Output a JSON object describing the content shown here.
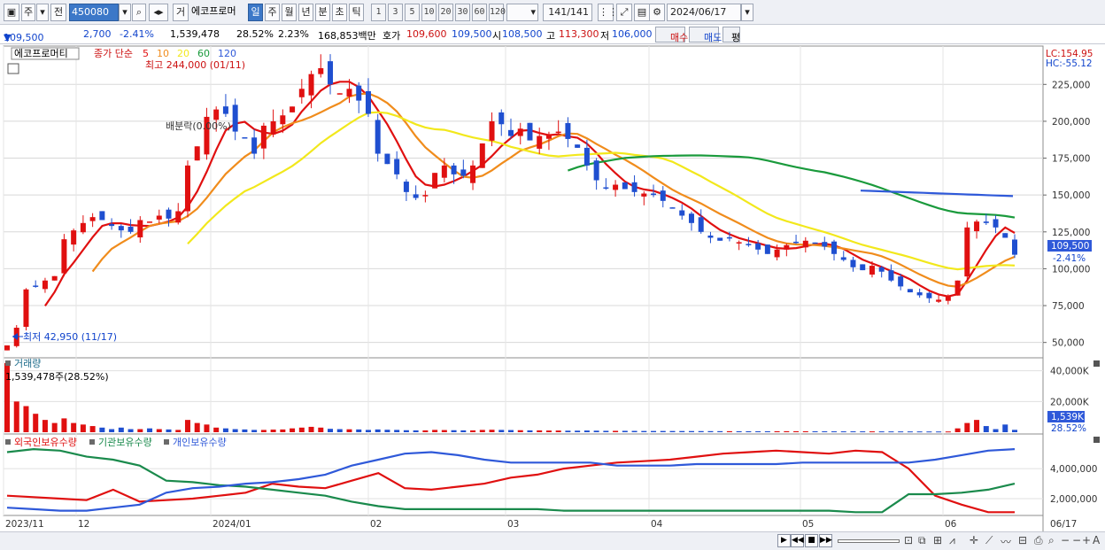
{
  "toolbar": {
    "market": "주",
    "prev": "전",
    "code": "450080",
    "name_btn": "거",
    "stock_name": "에코프로머",
    "periods": [
      "일",
      "주",
      "월",
      "년",
      "분",
      "초",
      "틱"
    ],
    "active_period": "일",
    "minute_options": [
      "1",
      "3",
      "5",
      "10",
      "20",
      "30",
      "60",
      "120"
    ],
    "count": "141",
    "total": "/141",
    "date": "2024/06/17"
  },
  "quote": {
    "price": "109,500",
    "direction": "▼",
    "change": "2,700",
    "change_pct": "-2.41%",
    "volume": "1,539,478",
    "turnover": "28.52%",
    "ratio": "2.23%",
    "amount": "168,853백만",
    "bid_label": "호가",
    "bid1": "109,600",
    "bid2": "109,500",
    "open_label": "시",
    "open": "108,500",
    "high_label": "고",
    "high": "113,300",
    "low_label": "저",
    "low": "106,000",
    "buy_btn": "매수",
    "sell_btn": "매도",
    "eval_btn": "평"
  },
  "price_panel": {
    "name_tag": "에코프로머티",
    "ma_title": "종가 단순",
    "ma_periods": [
      "5",
      "10",
      "20",
      "60",
      "120"
    ],
    "ma_colors": [
      "#e01010",
      "#f08c1c",
      "#f2e81c",
      "#1a9a3c",
      "#2f59d9"
    ],
    "high_note": "최고 244,000 (01/11)",
    "low_note": "최저 42,950 (11/17)",
    "lc": "LC:154.95",
    "hc": "HC:-55.12",
    "last_price_tag": "109,500",
    "last_pct_tag": "-2.41%",
    "overlay_note": "배분락(0.00%)",
    "axis_labels": [
      "225,000",
      "200,000",
      "175,000",
      "150,000",
      "125,000",
      "100,000",
      "75,000",
      "50,000"
    ]
  },
  "volume_panel": {
    "title": "거래량",
    "value_note": "1,539,478주(28.52%)",
    "axis_labels": [
      "40,000K",
      "20,000K"
    ],
    "last_tag": "1,539K",
    "last_pct": "28.52%"
  },
  "holder_panel": {
    "series_names": [
      "외국인보유수량",
      "기관보유수량",
      "개인보유수량"
    ],
    "series_colors": [
      "#e01010",
      "#1a8a4c",
      "#2f59d9"
    ],
    "axis_labels": [
      "4,000,000",
      "2,000,000"
    ]
  },
  "date_axis": {
    "labels": [
      "2023/11",
      "12",
      "2024/01",
      "02",
      "03",
      "04",
      "05",
      "06",
      "06/17"
    ]
  },
  "chart_data": [
    {
      "type": "candlestick",
      "title": "",
      "ylim": [
        42950,
        244000
      ],
      "ohlc_note": "daily price candles 2023/11 - 2024/06/17",
      "key_points": [
        {
          "x": "2023/11/17",
          "low": 42950
        },
        {
          "x": "2024/01/11",
          "high": 244000
        },
        {
          "x": "2024/06/17",
          "open": 108500,
          "high": 113300,
          "low": 106000,
          "close": 109500
        }
      ],
      "closes": [
        48000,
        60000,
        86000,
        88000,
        92000,
        95000,
        120000,
        126000,
        131000,
        135000,
        133000,
        129000,
        126000,
        125000,
        133000,
        132000,
        136000,
        134000,
        139000,
        170000,
        183000,
        203000,
        208000,
        205000,
        193000,
        189000,
        178000,
        197000,
        200000,
        204000,
        210000,
        222000,
        232000,
        236000,
        225000,
        219000,
        222000,
        214000,
        205000,
        178000,
        171000,
        164000,
        152000,
        148000,
        150000,
        165000,
        170000,
        164000,
        163000,
        170000,
        185000,
        200000,
        198000,
        190000,
        195000,
        187000,
        190000,
        191000,
        193000,
        188000,
        182000,
        170000,
        160000,
        155000,
        157000,
        154000,
        152000,
        151000,
        150000,
        146000,
        141000,
        136000,
        131000,
        125000,
        121000,
        119000,
        121000,
        118000,
        116000,
        113000,
        110000,
        113000,
        116000,
        118000,
        119000,
        117000,
        115000,
        110000,
        106000,
        101000,
        99000,
        102000,
        98000,
        92000,
        88000,
        84000,
        82000,
        80000,
        79000,
        81000,
        92000,
        128000,
        132000,
        131000,
        128000,
        121000,
        109500
      ]
    },
    {
      "type": "bar",
      "title": "거래량",
      "ylim": [
        0,
        45000000
      ],
      "last_value": 1539478,
      "values": [
        45000000,
        20000000,
        17000000,
        12000000,
        8000000,
        6000000,
        9000000,
        6000000,
        5000000,
        4000000,
        3000000,
        2000000,
        3000000,
        2000000,
        2000000,
        2500000,
        2000000,
        1800000,
        1500000,
        8000000,
        6000000,
        5000000,
        3000000,
        2500000,
        2000000,
        1800000,
        1500000,
        1500000,
        1700000,
        1800000,
        2500000,
        3000000,
        3500000,
        3000000,
        2200000,
        2000000,
        1900000,
        1800000,
        1500000,
        1800000,
        1600000,
        1500000,
        1300000,
        1200000,
        1200000,
        1500000,
        1400000,
        1300000,
        1200000,
        1200000,
        1500000,
        1600000,
        1500000,
        1400000,
        1300000,
        1200000,
        1200000,
        1100000,
        1100000,
        1000000,
        1000000,
        1100000,
        1000000,
        900000,
        900000,
        900000,
        850000,
        800000,
        800000,
        800000,
        780000,
        760000,
        740000,
        720000,
        700000,
        680000,
        660000,
        640000,
        620000,
        600000,
        620000,
        640000,
        650000,
        640000,
        630000,
        600000,
        580000,
        560000,
        550000,
        560000,
        550000,
        540000,
        530000,
        520000,
        510000,
        500000,
        500000,
        480000,
        470000,
        480000,
        2500000,
        6000000,
        8000000,
        4000000,
        2000000,
        5000000,
        1539478
      ]
    },
    {
      "type": "line",
      "title": "",
      "series": [
        {
          "name": "외국인보유수량",
          "values": [
            2200000,
            2100000,
            2000000,
            1900000,
            2600000,
            1800000,
            1900000,
            2000000,
            2200000,
            2400000,
            3000000,
            2800000,
            2700000,
            3200000,
            3700000,
            2700000,
            2600000,
            2800000,
            3000000,
            3400000,
            3600000,
            4000000,
            4200000,
            4400000,
            4500000,
            4600000,
            4800000,
            5000000,
            5100000,
            5200000,
            5100000,
            5000000,
            5200000,
            5100000,
            4000000,
            2200000,
            1600000,
            1100000,
            1100000
          ]
        },
        {
          "name": "기관보유수량",
          "values": [
            5100000,
            5300000,
            5200000,
            4800000,
            4600000,
            4200000,
            3200000,
            3100000,
            2900000,
            2800000,
            2600000,
            2400000,
            2200000,
            1800000,
            1500000,
            1300000,
            1300000,
            1300000,
            1300000,
            1300000,
            1300000,
            1200000,
            1200000,
            1200000,
            1200000,
            1200000,
            1200000,
            1200000,
            1200000,
            1200000,
            1200000,
            1200000,
            1100000,
            1100000,
            2300000,
            2300000,
            2400000,
            2600000,
            3000000
          ]
        },
        {
          "name": "개인보유수량",
          "values": [
            1400000,
            1300000,
            1200000,
            1200000,
            1400000,
            1600000,
            2400000,
            2700000,
            2800000,
            3000000,
            3100000,
            3300000,
            3600000,
            4200000,
            4600000,
            5000000,
            5100000,
            4900000,
            4600000,
            4400000,
            4400000,
            4400000,
            4400000,
            4200000,
            4200000,
            4200000,
            4300000,
            4300000,
            4300000,
            4300000,
            4400000,
            4400000,
            4400000,
            4400000,
            4400000,
            4600000,
            4900000,
            5200000,
            5300000
          ]
        }
      ],
      "ylim": [
        1000000,
        5600000
      ]
    }
  ]
}
